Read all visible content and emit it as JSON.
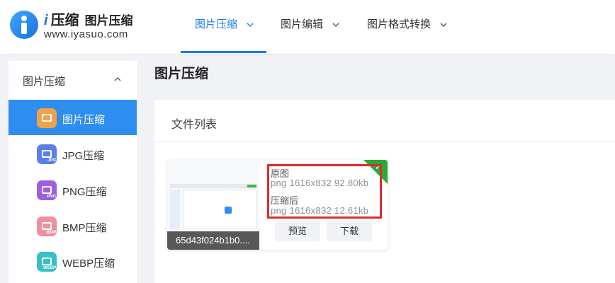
{
  "header": {
    "logo_mark": "i",
    "logo_name": "压缩",
    "logo_subtitle": "图片压缩",
    "logo_url": "www.iyasuo.com",
    "nav": [
      {
        "label": "图片压缩",
        "active": true
      },
      {
        "label": "图片编辑",
        "active": false
      },
      {
        "label": "图片格式转换",
        "active": false
      }
    ]
  },
  "sidebar": {
    "group_label": "图片压缩",
    "items": [
      {
        "label": "图片压缩",
        "icon": "image-compress-icon",
        "color": "#f0a24a",
        "active": true
      },
      {
        "label": "JPG压缩",
        "icon": "jpg-icon",
        "tag": "JPG",
        "color": "#5b7fe8",
        "active": false
      },
      {
        "label": "PNG压缩",
        "icon": "png-icon",
        "tag": "PNG",
        "color": "#9b5fe0",
        "active": false
      },
      {
        "label": "BMP压缩",
        "icon": "bmp-icon",
        "tag": "BMP",
        "color": "#ef8fa0",
        "active": false
      },
      {
        "label": "WEBP压缩",
        "icon": "webp-icon",
        "tag": "WEBP",
        "color": "#35c0c7",
        "active": false
      }
    ]
  },
  "main": {
    "page_title": "图片压缩",
    "panel_title": "文件列表",
    "file": {
      "name": "65d43f024b1b0....",
      "original_label": "原图",
      "original_meta": "png  1616x832  92.80kb",
      "compressed_label": "压缩后",
      "compressed_meta": "png  1616x832  12.61kb",
      "preview_label": "预览",
      "download_label": "下载",
      "status": "done"
    }
  },
  "colors": {
    "accent": "#1a7de6",
    "active_bg": "#2e8ef0",
    "success": "#2aa83a",
    "highlight": "#e02b2b"
  }
}
